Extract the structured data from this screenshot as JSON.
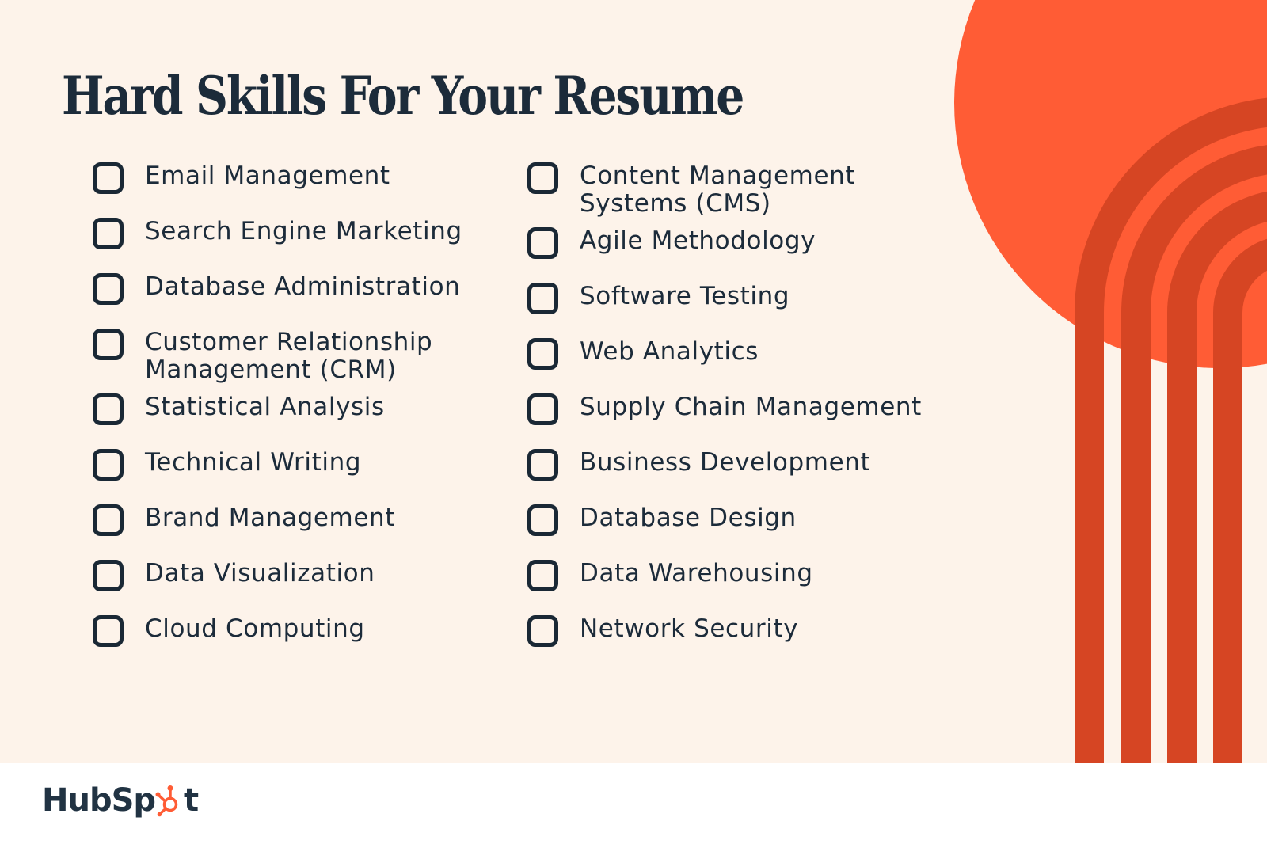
{
  "title": "Hard Skills For Your Resume",
  "colors": {
    "background": "#fdf3ea",
    "text": "#1c2b3a",
    "circle": "#ff5c35",
    "stripes": "#d64523",
    "footer": "#ffffff"
  },
  "left_column": [
    {
      "label": "Email Management",
      "checked": false
    },
    {
      "label": "Search Engine Marketing",
      "checked": false
    },
    {
      "label": "Database Administration",
      "checked": false
    },
    {
      "label": "Customer Relationship\nManagement (CRM)",
      "checked": false
    },
    {
      "label": "Statistical Analysis",
      "checked": false
    },
    {
      "label": "Technical Writing",
      "checked": false
    },
    {
      "label": "Brand Management",
      "checked": false
    },
    {
      "label": "Data Visualization",
      "checked": false
    },
    {
      "label": "Cloud Computing",
      "checked": false
    }
  ],
  "right_column": [
    {
      "label": "Content Management\nSystems (CMS)",
      "checked": false
    },
    {
      "label": "Agile Methodology",
      "checked": false
    },
    {
      "label": "Software Testing",
      "checked": false
    },
    {
      "label": "Web Analytics",
      "checked": false
    },
    {
      "label": "Supply Chain Management",
      "checked": false
    },
    {
      "label": "Business Development",
      "checked": false
    },
    {
      "label": "Database Design",
      "checked": false
    },
    {
      "label": "Data Warehousing",
      "checked": false
    },
    {
      "label": "Network Security",
      "checked": false
    }
  ],
  "footer": {
    "logo_text_before": "HubSp",
    "logo_text_after": "t",
    "logo_icon": "sprocket-icon"
  }
}
